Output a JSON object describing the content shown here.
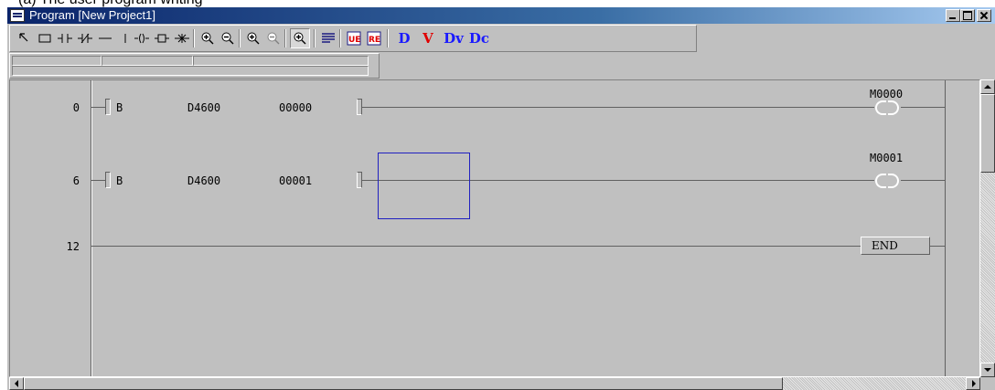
{
  "caption": "(a) The user program writing",
  "window": {
    "title": "Program [New Project1]"
  },
  "toolbar": {
    "icons": [
      "select-arrow-icon",
      "box-icon",
      "contact-no-icon",
      "contact-nc-icon",
      "horizontal-line-icon",
      "vertical-line-icon",
      "coil-icon",
      "function-icon",
      "star-icon",
      "zoom-in-icon",
      "zoom-out-icon",
      "zoom-in-2-icon",
      "zoom-out-2-icon",
      "zoom-fit-icon",
      "list-icon",
      "ue-icon",
      "re-icon"
    ],
    "text_buttons": [
      {
        "label": "D",
        "color": "#1a1aff"
      },
      {
        "label": "V",
        "color": "#e00000"
      },
      {
        "label": "Dv",
        "color": "#1a1aff",
        "sub_color": "#e00000"
      },
      {
        "label": "Dc",
        "color": "#1a1aff",
        "sub_color": "#009000"
      }
    ]
  },
  "ladder": {
    "rungs": [
      {
        "step": "0",
        "instr": "B",
        "operand1": "D4600",
        "operand2": "00000",
        "coil": "M0000"
      },
      {
        "step": "6",
        "instr": "B",
        "operand1": "D4600",
        "operand2": "00001",
        "coil": "M0001"
      }
    ],
    "end": {
      "step": "12",
      "label": "END"
    }
  }
}
